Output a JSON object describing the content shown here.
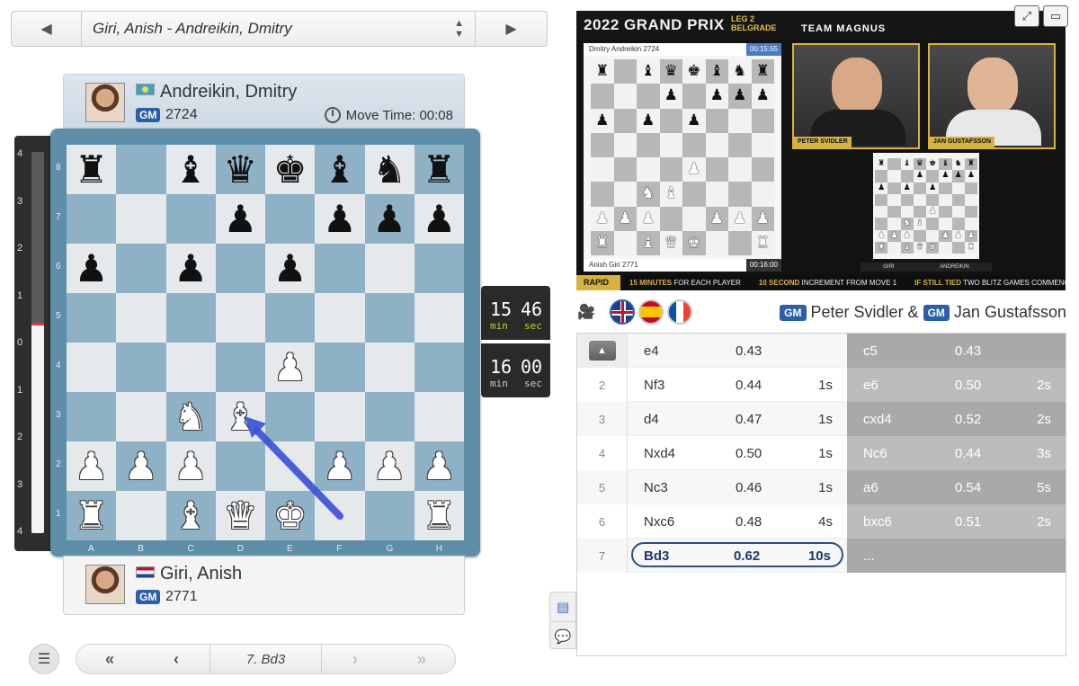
{
  "game_selector": {
    "title": "Giri, Anish - Andreikin, Dmitry",
    "prev_icon": "triangle-left",
    "next_icon": "triangle-right",
    "toggle_icon": "up-down-arrows"
  },
  "top_player": {
    "name": "Andreikin, Dmitry",
    "title": "GM",
    "rating": "2724",
    "flag": "Kazakhstan",
    "move_time_label": "Move Time: 00:08"
  },
  "bottom_player": {
    "name": "Giri, Anish",
    "title": "GM",
    "rating": "2771",
    "flag": "Netherlands"
  },
  "eval_bar": {
    "labels": [
      "4",
      "3",
      "2",
      "1",
      "0",
      "1",
      "2",
      "3",
      "4"
    ],
    "white_fraction": 0.55
  },
  "board": {
    "ranks": [
      "8",
      "7",
      "6",
      "5",
      "4",
      "3",
      "2",
      "1"
    ],
    "files": [
      "A",
      "B",
      "C",
      "D",
      "E",
      "F",
      "G",
      "H"
    ],
    "position": [
      [
        "bR",
        "",
        "bB",
        "bQ",
        "bK",
        "bB",
        "bN",
        "bR"
      ],
      [
        "",
        "",
        "",
        "bP",
        "",
        "bP",
        "bP",
        "bP"
      ],
      [
        "bP",
        "",
        "bP",
        "",
        "bP",
        "",
        "",
        ""
      ],
      [
        "",
        "",
        "",
        "",
        "",
        "",
        "",
        ""
      ],
      [
        "",
        "",
        "",
        "",
        "wP",
        "",
        "",
        ""
      ],
      [
        "",
        "",
        "wN",
        "wB",
        "",
        "",
        "",
        ""
      ],
      [
        "wP",
        "wP",
        "wP",
        "",
        "",
        "wP",
        "wP",
        "wP"
      ],
      [
        "wR",
        "",
        "wB",
        "wQ",
        "wK",
        "",
        "",
        "wR"
      ]
    ],
    "last_move_arrow": {
      "from": "f1",
      "to": "d3",
      "color": "#3a4fd8"
    }
  },
  "clocks": {
    "top": {
      "min": "15",
      "sec": "46",
      "min_label": "min",
      "sec_label": "sec"
    },
    "bottom": {
      "min": "16",
      "sec": "00",
      "min_label": "min",
      "sec_label": "sec"
    }
  },
  "nav": {
    "current_move": "7. Bd3",
    "first_icon": "double-chevron-left",
    "prev_icon": "chevron-left",
    "next_icon": "chevron-right",
    "last_icon": "double-chevron-right",
    "menu_icon": "hamburger-icon"
  },
  "video": {
    "title": "2022 GRAND PRIX",
    "leg_line1": "LEG 2",
    "leg_line2": "BELGRADE",
    "team": "TEAM MAGNUS",
    "board_white_player": "Anish Giri 2771",
    "board_black_player": "Dmitry Andreikin 2724",
    "board_top_timer": "00:15:55",
    "board_bottom_timer": "00:16:00",
    "cam1_name": "PETER SVIDLER",
    "cam2_name": "JAN GUSTAFSSON",
    "minibar_left": "GIRI",
    "minibar_right": "ANDREIKIN",
    "ticker": {
      "format": "RAPID GAMES",
      "item1_bold": "15 MINUTES",
      "item1": "FOR EACH PLAYER",
      "item2_bold": "10 SECOND",
      "item2": "INCREMENT FROM MOVE 1",
      "item3_bold": "IF STILL TIED",
      "item3": "TWO BLITZ GAMES COMMENCE"
    }
  },
  "commentary": {
    "languages": [
      "English",
      "Spanish",
      "French"
    ],
    "active_language": "English",
    "commentator1_title": "GM",
    "commentator1": "Peter Svidler &",
    "commentator2_title": "GM",
    "commentator2": "Jan Gustafsson"
  },
  "moves": [
    {
      "num": "1",
      "white": "e4",
      "w_eval": "0.43",
      "w_time": "",
      "black": "c5",
      "b_eval": "0.43",
      "b_time": ""
    },
    {
      "num": "2",
      "white": "Nf3",
      "w_eval": "0.44",
      "w_time": "1s",
      "black": "e6",
      "b_eval": "0.50",
      "b_time": "2s"
    },
    {
      "num": "3",
      "white": "d4",
      "w_eval": "0.47",
      "w_time": "1s",
      "black": "cxd4",
      "b_eval": "0.52",
      "b_time": "2s"
    },
    {
      "num": "4",
      "white": "Nxd4",
      "w_eval": "0.50",
      "w_time": "1s",
      "black": "Nc6",
      "b_eval": "0.44",
      "b_time": "3s"
    },
    {
      "num": "5",
      "white": "Nc3",
      "w_eval": "0.46",
      "w_time": "1s",
      "black": "a6",
      "b_eval": "0.54",
      "b_time": "5s"
    },
    {
      "num": "6",
      "white": "Nxc6",
      "w_eval": "0.48",
      "w_time": "4s",
      "black": "bxc6",
      "b_eval": "0.51",
      "b_time": "2s"
    },
    {
      "num": "7",
      "white": "Bd3",
      "w_eval": "0.62",
      "w_time": "10s",
      "black": "...",
      "b_eval": "",
      "b_time": ""
    }
  ]
}
